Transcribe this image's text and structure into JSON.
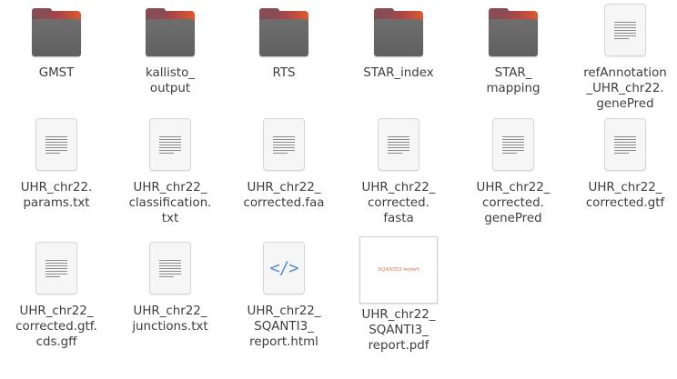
{
  "colors": {
    "folder_accent": "#e0592c",
    "folder_body": "#666666",
    "code_icon": "#5b8ed8",
    "label_text": "#3d3d3d"
  },
  "items": [
    {
      "name": "GMST",
      "icon": "folder-icon"
    },
    {
      "name": "kallisto_\noutput",
      "icon": "folder-icon"
    },
    {
      "name": "RTS",
      "icon": "folder-icon"
    },
    {
      "name": "STAR_index",
      "icon": "folder-icon"
    },
    {
      "name": "STAR_\nmapping",
      "icon": "folder-icon"
    },
    {
      "name": "refAnnotation\n_UHR_chr22.\ngenePred",
      "icon": "text-file-icon"
    },
    {
      "name": "UHR_chr22.\nparams.txt",
      "icon": "text-file-icon"
    },
    {
      "name": "UHR_chr22_\nclassification.\ntxt",
      "icon": "text-file-icon"
    },
    {
      "name": "UHR_chr22_\ncorrected.faa",
      "icon": "text-file-icon"
    },
    {
      "name": "UHR_chr22_\ncorrected.\nfasta",
      "icon": "text-file-icon"
    },
    {
      "name": "UHR_chr22_\ncorrected.\ngenePred",
      "icon": "text-file-icon"
    },
    {
      "name": "UHR_chr22_\ncorrected.gtf",
      "icon": "text-file-icon"
    },
    {
      "name": "UHR_chr22_\ncorrected.gtf.\ncds.gff",
      "icon": "text-file-icon"
    },
    {
      "name": "UHR_chr22_\njunctions.txt",
      "icon": "text-file-icon"
    },
    {
      "name": "UHR_chr22_\nSQANTI3_\nreport.html",
      "icon": "code-file-icon",
      "glyph": "</>"
    },
    {
      "name": "UHR_chr22_\nSQANTI3_\nreport.pdf",
      "icon": "pdf-thumbnail",
      "thumb_text": "SQANTI3 report"
    }
  ]
}
